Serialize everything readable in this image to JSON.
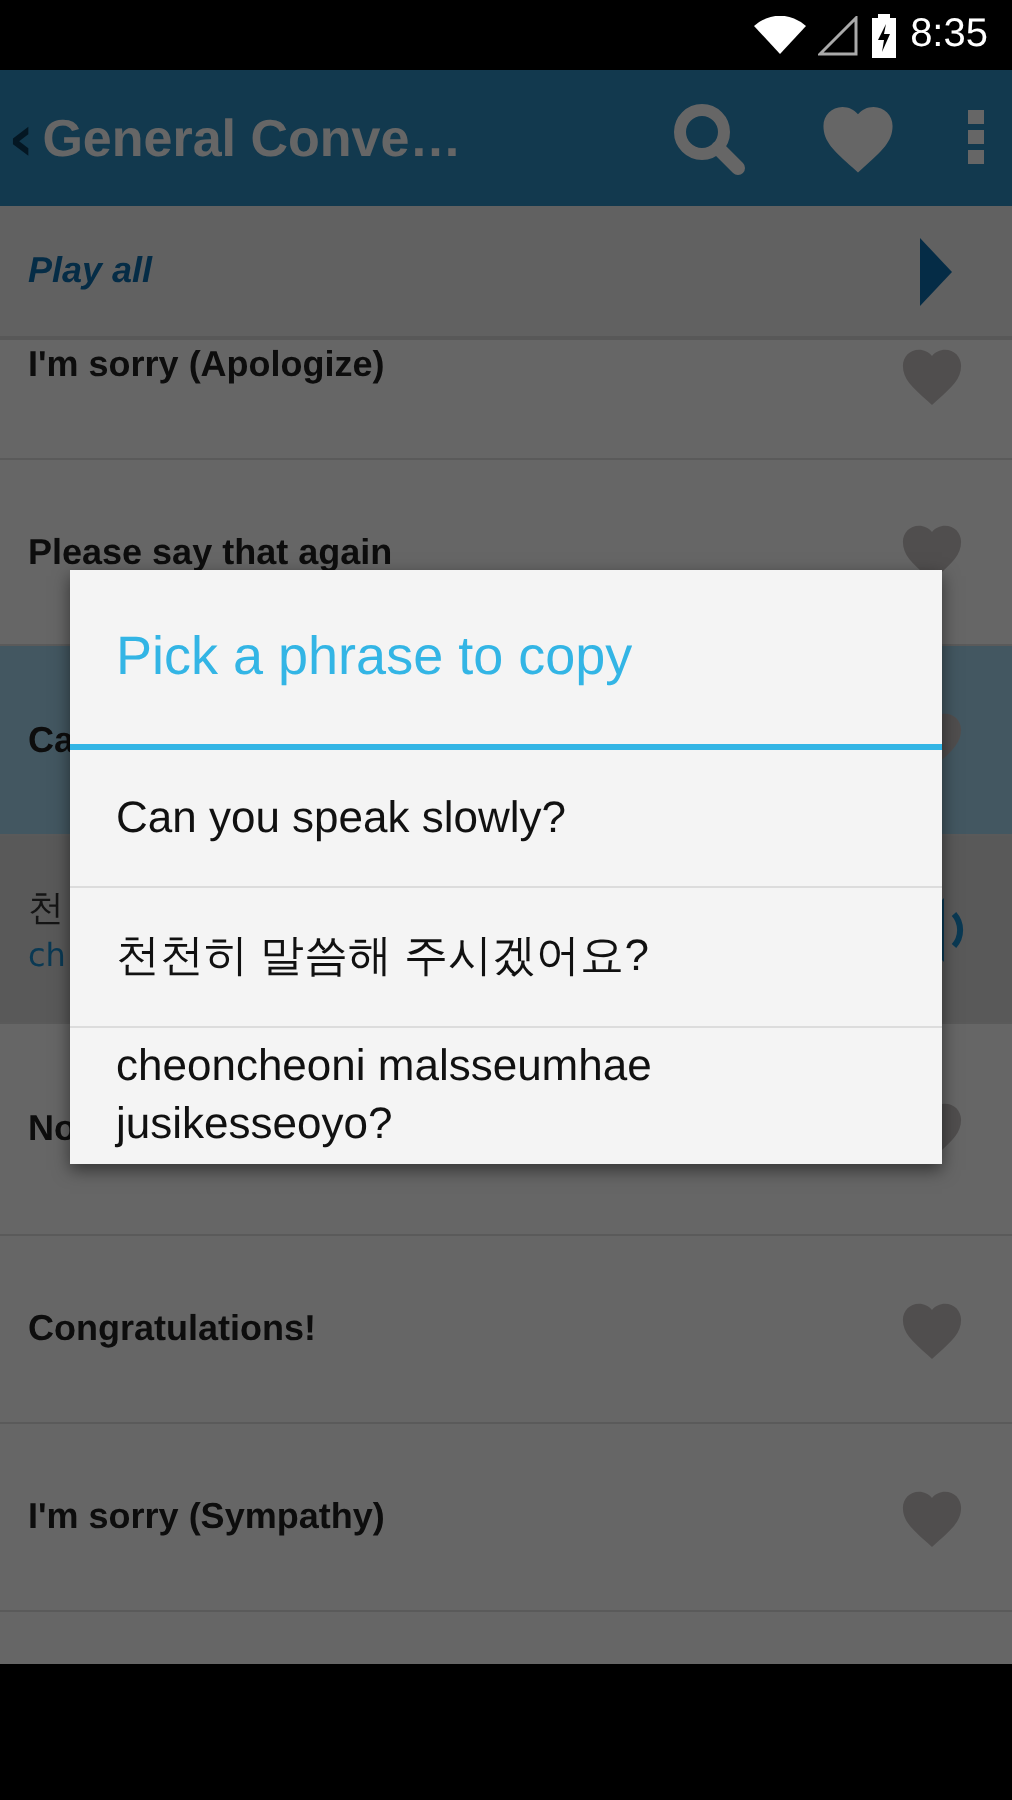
{
  "status_bar": {
    "time": "8:35"
  },
  "app_bar": {
    "back": "‹",
    "title": "General Conve…"
  },
  "play_all": {
    "label": "Play all"
  },
  "rows": [
    {
      "kind": "phrase",
      "text": "I'm sorry (Apologize)",
      "selected": false
    },
    {
      "kind": "phrase",
      "text": "Please say that again",
      "selected": false
    },
    {
      "kind": "phrase",
      "text": "Ca",
      "selected": true
    },
    {
      "kind": "translation",
      "native": "천",
      "romanized": "ch",
      "selected": false
    },
    {
      "kind": "phrase",
      "text": "No",
      "selected": false
    },
    {
      "kind": "phrase",
      "text": "Congratulations!",
      "selected": false
    },
    {
      "kind": "phrase",
      "text": "I'm sorry (Sympathy)",
      "selected": false
    }
  ],
  "dialog": {
    "title": "Pick a phrase to copy",
    "options": [
      "Can you speak slowly?",
      "천천히 말씀해 주시겠어요?",
      "cheoncheoni malsseumhae jusikesseoyo?"
    ]
  }
}
